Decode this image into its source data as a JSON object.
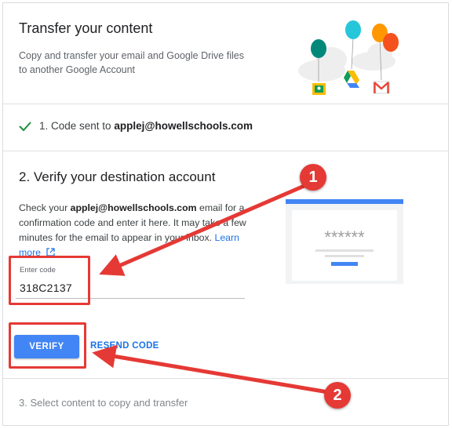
{
  "header": {
    "title": "Transfer your content",
    "subtitle": "Copy and transfer your email and Google Drive files to another Google Account"
  },
  "step1": {
    "prefix": "1. Code sent to ",
    "email": "applej@howellschools.com"
  },
  "step2": {
    "title": "2. Verify your destination account",
    "desc_prefix": "Check your ",
    "email": "applej@howellschools.com",
    "desc_suffix": " email for a confirmation code and enter it here. It may take a few minutes for the email to appear in your inbox. ",
    "learn_more": "Learn more",
    "code_label": "Enter code",
    "code_value": "318C2137",
    "verify_label": "VERIFY",
    "resend_label": "RESEND CODE",
    "illustration_mask": "******"
  },
  "step3": {
    "title": "3. Select content to copy and transfer"
  },
  "annotations": {
    "badge1": "1",
    "badge2": "2"
  },
  "colors": {
    "accent": "#4285f4",
    "link": "#1a73e8",
    "annotation_red": "#e53935",
    "check_green": "#1e8e3e"
  }
}
